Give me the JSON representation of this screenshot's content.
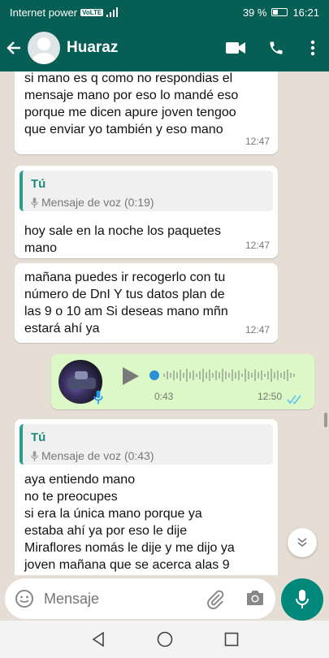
{
  "status_bar": {
    "carrier": "Internet power",
    "volte": "VoLTE",
    "battery": "39 %",
    "time": "16:21"
  },
  "header": {
    "contact_name": "Huaraz"
  },
  "messages": [
    {
      "text": [
        "si mano es q como no respondias el",
        "mensaje mano por eso lo mandé eso",
        "porque me dicen apure joven tengoo",
        "que enviar yo también y eso mano"
      ],
      "time": "12:47"
    },
    {
      "quote_author": "Tú",
      "quote_text": "Mensaje de voz (0:19)",
      "text": [
        "hoy sale en la noche los paquetes",
        "mano"
      ],
      "time": "12:47"
    },
    {
      "text": [
        "mañana puedes ir recogerlo con tu",
        "número de DnI Y tus datos plan de",
        "las 9 o 10 am Si deseas mano mñn",
        "estará ahí ya"
      ],
      "time": "12:47"
    },
    {
      "duration": "0:43",
      "time": "12:50"
    },
    {
      "quote_author": "Tú",
      "quote_text": "Mensaje de voz (0:43)",
      "text": [
        "aya entiendo mano",
        "no te preocupes",
        "si era la única mano porque ya",
        "estaba ahí ya por eso le dije",
        "Miraflores nomás le dije y me dijo ya",
        "joven mañana que se acerca alas 9"
      ]
    }
  ],
  "input": {
    "placeholder": "Mensaje"
  },
  "colors": {
    "header": "#075e54",
    "outgoing": "#dcf8c6",
    "accent": "#00897b",
    "read_ticks": "#4fc3f7"
  },
  "icons": [
    "back-arrow-icon",
    "video-call-icon",
    "phone-icon",
    "more-options-icon",
    "mic-icon",
    "play-icon",
    "emoji-icon",
    "attach-icon",
    "camera-icon",
    "chevron-down-icon"
  ]
}
